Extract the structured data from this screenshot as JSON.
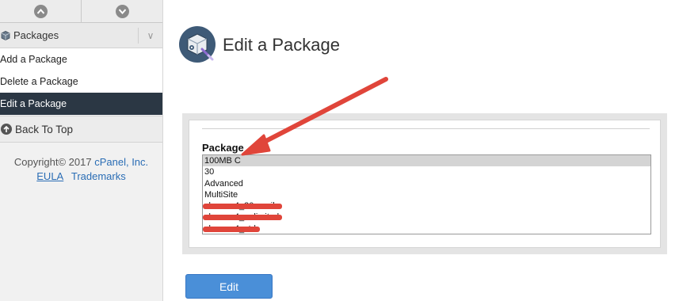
{
  "sidebar": {
    "section_title": "Packages",
    "collapse_glyph": "∨",
    "items": [
      {
        "label": "Add a Package"
      },
      {
        "label": "Delete a Package"
      },
      {
        "label": "Edit a Package",
        "active": true
      }
    ],
    "back_to_top": "Back To Top",
    "copyright_prefix": "Copyright© 2017",
    "company": "cPanel, Inc.",
    "eula": "EULA",
    "trademarks": "Trademarks"
  },
  "main": {
    "title": "Edit a Package",
    "package_label": "Package",
    "packages": [
      {
        "name": "100MB C",
        "selected": true
      },
      {
        "name": "30"
      },
      {
        "name": "Advanced"
      },
      {
        "name": "MultiSite"
      },
      {
        "name": "sbsmax4_30emails",
        "redacted": true
      },
      {
        "name": "sbsmax4_unlimited",
        "redacted": true
      },
      {
        "name": "sbsmax4_std",
        "redacted": true
      }
    ],
    "edit_button": "Edit"
  },
  "colors": {
    "accent": "#4a8fd8",
    "sidebar_active": "#2b3744",
    "annotation_arrow": "#e0453a"
  }
}
